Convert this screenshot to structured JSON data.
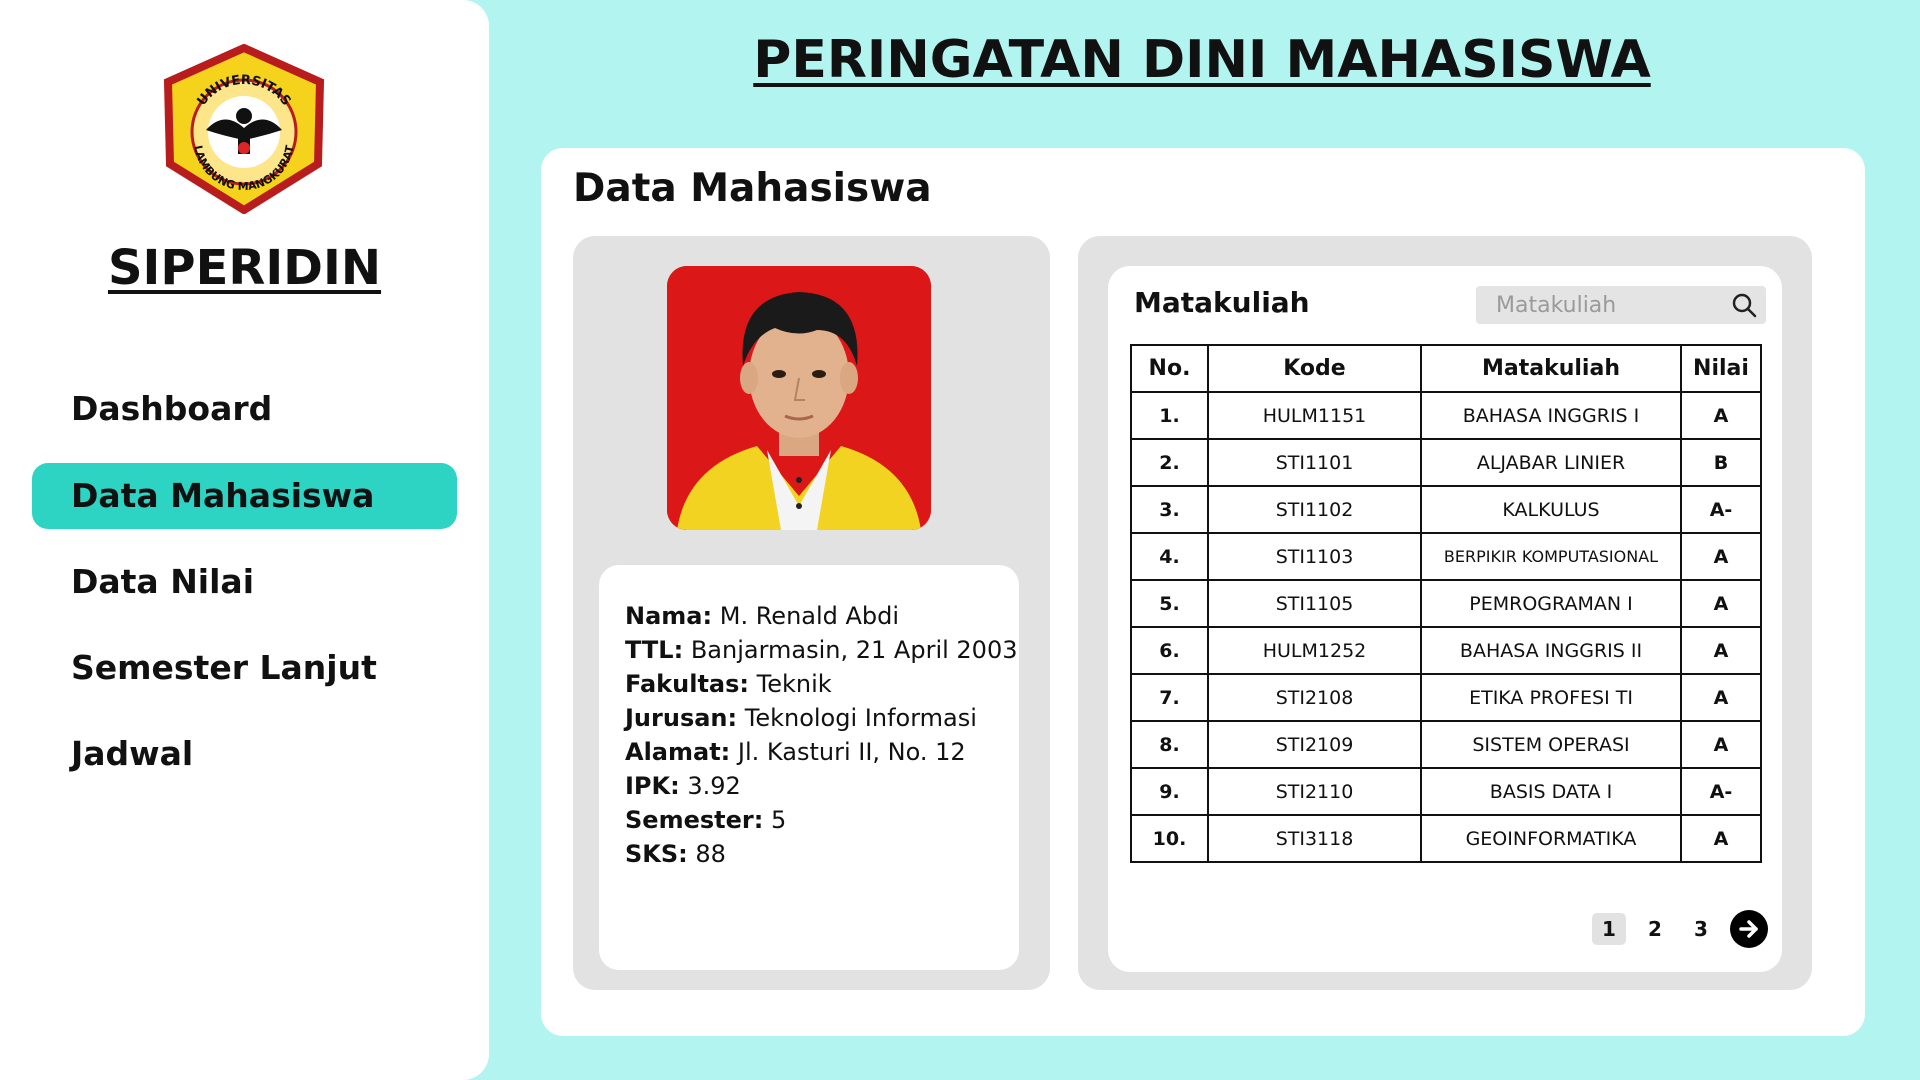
{
  "app": {
    "name": "SIPERIDIN",
    "logo_text_top": "UNIVERSITAS",
    "logo_text_bottom": "LAMBUNG MANGKURAT"
  },
  "sidebar": {
    "items": [
      {
        "label": "Dashboard",
        "active": false
      },
      {
        "label": "Data Mahasiswa",
        "active": true
      },
      {
        "label": "Data Nilai",
        "active": false
      },
      {
        "label": "Semester Lanjut",
        "active": false
      },
      {
        "label": "Jadwal",
        "active": false
      }
    ]
  },
  "header": {
    "title": "PERINGATAN DINI MAHASISWA"
  },
  "main": {
    "section_title": "Data Mahasiswa",
    "profile": {
      "fields": [
        {
          "label": "Nama:",
          "value": "M. Renald Abdi"
        },
        {
          "label": "TTL:",
          "value": "Banjarmasin, 21 April 2003"
        },
        {
          "label": "Fakultas:",
          "value": "Teknik"
        },
        {
          "label": "Jurusan:",
          "value": "Teknologi Informasi"
        },
        {
          "label": "Alamat:",
          "value": "Jl. Kasturi II, No. 12"
        },
        {
          "label": "IPK:",
          "value": "3.92"
        },
        {
          "label": "Semester:",
          "value": "5"
        },
        {
          "label": "SKS:",
          "value": "88"
        }
      ]
    },
    "courses": {
      "title": "Matakuliah",
      "search_placeholder": "Matakuliah",
      "columns": [
        "No.",
        "Kode",
        "Matakuliah",
        "Nilai"
      ],
      "rows": [
        {
          "no": "1.",
          "kode": "HULM1151",
          "nama": "BAHASA INGGRIS I",
          "nilai": "A"
        },
        {
          "no": "2.",
          "kode": "STI1101",
          "nama": "ALJABAR LINIER",
          "nilai": "B"
        },
        {
          "no": "3.",
          "kode": "STI1102",
          "nama": "KALKULUS",
          "nilai": "A-"
        },
        {
          "no": "4.",
          "kode": "STI1103",
          "nama": "BERPIKIR KOMPUTASIONAL",
          "nilai": "A"
        },
        {
          "no": "5.",
          "kode": "STI1105",
          "nama": "PEMROGRAMAN I",
          "nilai": "A"
        },
        {
          "no": "6.",
          "kode": "HULM1252",
          "nama": "BAHASA INGGRIS II",
          "nilai": "A"
        },
        {
          "no": "7.",
          "kode": "STI2108",
          "nama": "ETIKA PROFESI TI",
          "nilai": "A"
        },
        {
          "no": "8.",
          "kode": "STI2109",
          "nama": "SISTEM OPERASI",
          "nilai": "A"
        },
        {
          "no": "9.",
          "kode": "STI2110",
          "nama": "BASIS DATA I",
          "nilai": "A-"
        },
        {
          "no": "10.",
          "kode": "STI3118",
          "nama": "GEOINFORMATIKA",
          "nilai": "A"
        }
      ],
      "pagination": {
        "pages": [
          "1",
          "2",
          "3"
        ],
        "current": "1"
      }
    }
  },
  "colors": {
    "background": "#b2f4ef",
    "accent": "#2dd3c3",
    "panel": "#e2e2e2",
    "photo_bg": "#dc1717"
  }
}
